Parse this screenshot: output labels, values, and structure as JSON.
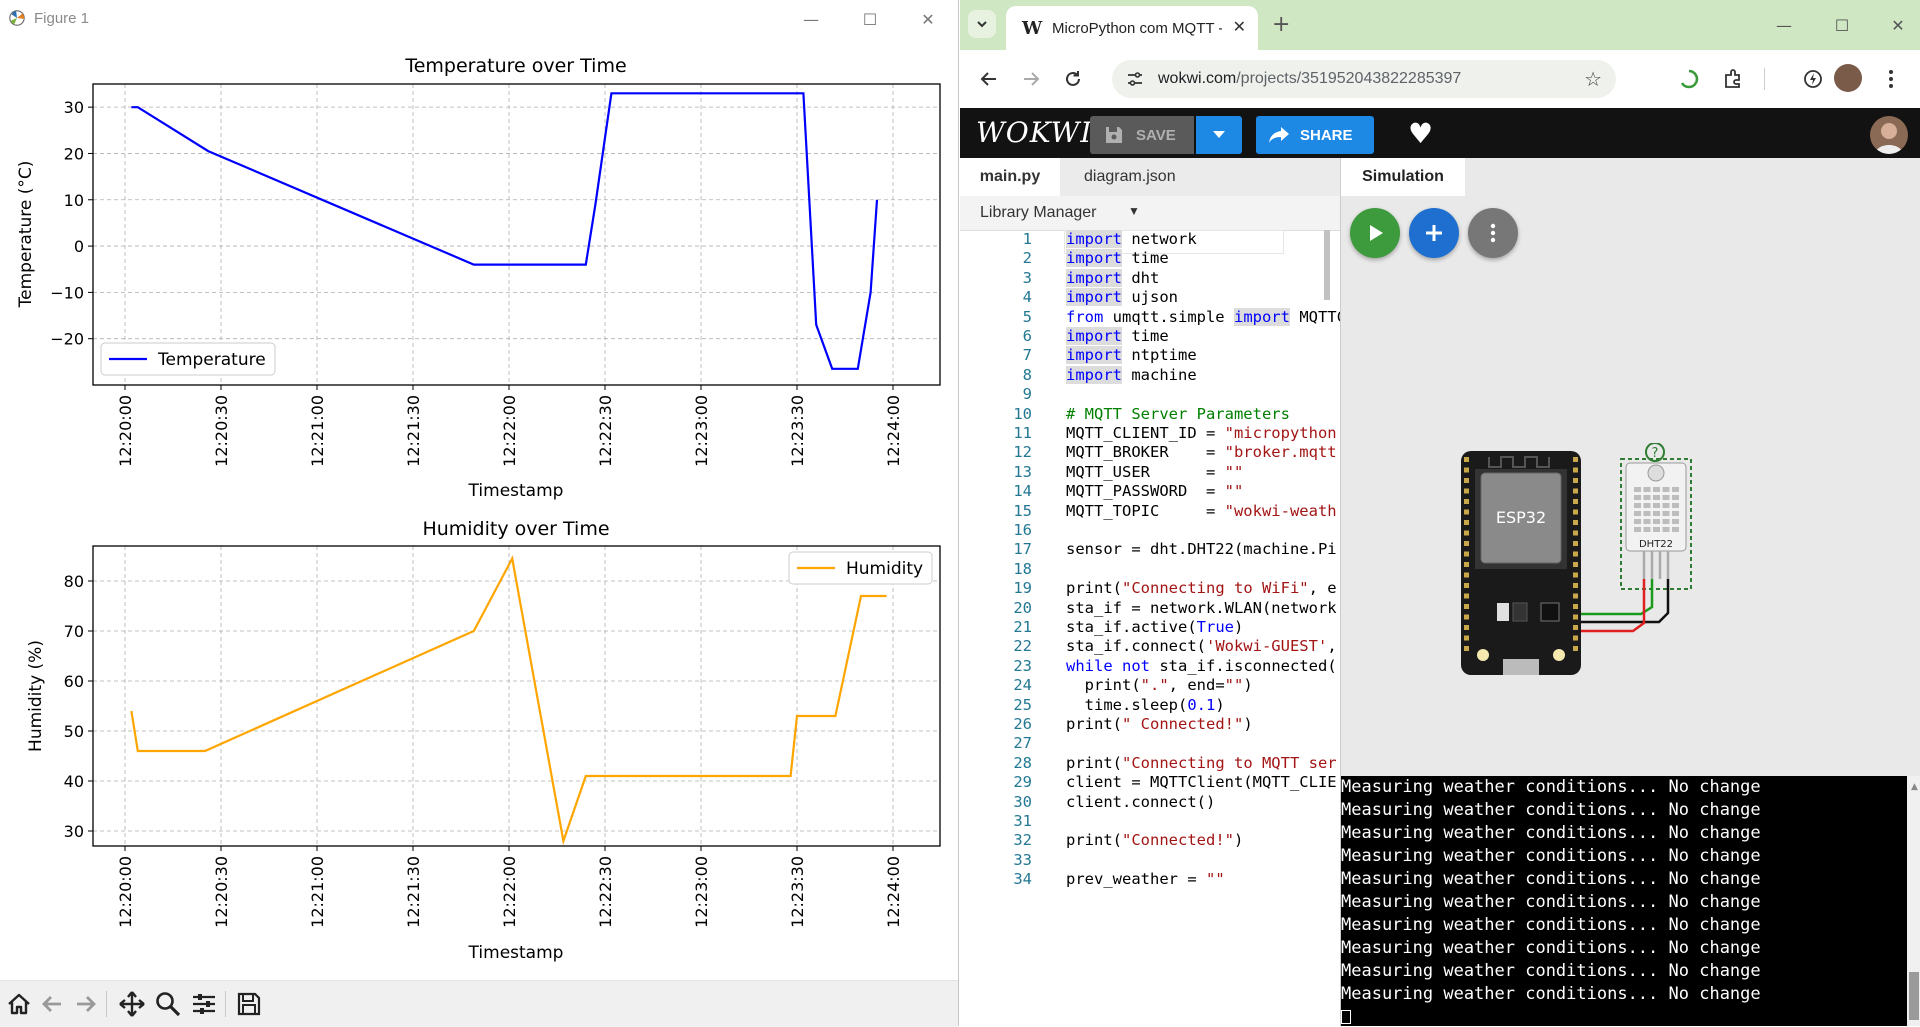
{
  "figure": {
    "window_title": "Figure 1",
    "plot1": {
      "title": "Temperature over Time",
      "ylabel": "Temperature (°C)",
      "xlabel": "Timestamp",
      "legend": "Temperature",
      "yticks": [
        "30",
        "20",
        "10",
        "0",
        "−10",
        "−20"
      ],
      "xticks": [
        "12:20:00",
        "12:20:30",
        "12:21:00",
        "12:21:30",
        "12:22:00",
        "12:22:30",
        "12:23:00",
        "12:23:30",
        "12:24:00"
      ]
    },
    "plot2": {
      "title": "Humidity over Time",
      "ylabel": "Humidity (%)",
      "xlabel": "Timestamp",
      "legend": "Humidity",
      "yticks": [
        "80",
        "70",
        "60",
        "50",
        "40",
        "30"
      ],
      "xticks": [
        "12:20:00",
        "12:20:30",
        "12:21:00",
        "12:21:30",
        "12:22:00",
        "12:22:30",
        "12:23:00",
        "12:23:30",
        "12:24:00"
      ]
    },
    "colors": {
      "temperature": "#0000ff",
      "humidity": "#ffa500"
    }
  },
  "chart_data": [
    {
      "type": "line",
      "title": "Temperature over Time",
      "xlabel": "Timestamp",
      "ylabel": "Temperature (°C)",
      "ylim": [
        -30,
        35
      ],
      "legend": "lower-left",
      "grid": true,
      "series": [
        {
          "name": "Temperature",
          "color": "#0000ff",
          "x": [
            "12:20:02",
            "12:20:04",
            "12:20:26",
            "12:21:49",
            "12:22:24",
            "12:22:27",
            "12:22:32",
            "12:23:32",
            "12:23:36",
            "12:23:41",
            "12:23:49",
            "12:23:53",
            "12:23:55"
          ],
          "y": [
            30,
            30,
            20.5,
            -4,
            -4,
            9,
            33,
            33,
            -17,
            -26.5,
            -26.5,
            -10,
            10
          ]
        }
      ]
    },
    {
      "type": "line",
      "title": "Humidity over Time",
      "xlabel": "Timestamp",
      "ylabel": "Humidity (%)",
      "ylim": [
        27,
        87
      ],
      "legend": "top-right",
      "grid": true,
      "series": [
        {
          "name": "Humidity",
          "color": "#ffa500",
          "x": [
            "12:20:02",
            "12:20:04",
            "12:20:25",
            "12:21:49",
            "12:22:01",
            "12:22:17",
            "12:22:24",
            "12:23:28",
            "12:23:30",
            "12:23:42",
            "12:23:50",
            "12:23:58"
          ],
          "y": [
            54,
            46,
            46,
            70,
            84.5,
            28,
            41,
            41,
            53,
            53,
            77,
            77
          ]
        }
      ]
    }
  ],
  "browser": {
    "tab_title": "MicroPython com MQTT - Wokwi",
    "url_host": "wokwi.com",
    "url_path": "/projects/351952043822285397"
  },
  "wokwi": {
    "logo": "WOKWI",
    "save_label": "SAVE",
    "share_label": "SHARE",
    "file_tabs": [
      "main.py",
      "diagram.json"
    ],
    "library_manager": "Library Manager",
    "sim_tab": "Simulation",
    "esp_label": "ESP32",
    "dht_label": "DHT22",
    "help_label": "?",
    "serial_lines": [
      "Measuring weather conditions... No change",
      "Measuring weather conditions... No change",
      "Measuring weather conditions... No change",
      "Measuring weather conditions... No change",
      "Measuring weather conditions... No change",
      "Measuring weather conditions... No change",
      "Measuring weather conditions... No change",
      "Measuring weather conditions... No change",
      "Measuring weather conditions... No change",
      "Measuring weather conditions... No change"
    ]
  },
  "code_lines": [
    {
      "n": "1",
      "t": "import network"
    },
    {
      "n": "2",
      "t": "import time"
    },
    {
      "n": "3",
      "t": "import dht"
    },
    {
      "n": "4",
      "t": "import ujson"
    },
    {
      "n": "5",
      "t": "from umqtt.simple import MQTTClient"
    },
    {
      "n": "6",
      "t": "import time"
    },
    {
      "n": "7",
      "t": "import ntptime"
    },
    {
      "n": "8",
      "t": "import machine"
    },
    {
      "n": "9",
      "t": ""
    },
    {
      "n": "10",
      "t": "# MQTT Server Parameters"
    },
    {
      "n": "11",
      "t": "MQTT_CLIENT_ID = \"micropython"
    },
    {
      "n": "12",
      "t": "MQTT_BROKER    = \"broker.mqtt"
    },
    {
      "n": "13",
      "t": "MQTT_USER      = \"\""
    },
    {
      "n": "14",
      "t": "MQTT_PASSWORD  = \"\""
    },
    {
      "n": "15",
      "t": "MQTT_TOPIC     = \"wokwi-weath"
    },
    {
      "n": "16",
      "t": ""
    },
    {
      "n": "17",
      "t": "sensor = dht.DHT22(machine.Pi"
    },
    {
      "n": "18",
      "t": ""
    },
    {
      "n": "19",
      "t": "print(\"Connecting to WiFi\", e"
    },
    {
      "n": "20",
      "t": "sta_if = network.WLAN(network"
    },
    {
      "n": "21",
      "t": "sta_if.active(True)"
    },
    {
      "n": "22",
      "t": "sta_if.connect('Wokwi-GUEST',"
    },
    {
      "n": "23",
      "t": "while not sta_if.isconnected("
    },
    {
      "n": "24",
      "t": "  print(\".\", end=\"\")"
    },
    {
      "n": "25",
      "t": "  time.sleep(0.1)"
    },
    {
      "n": "26",
      "t": "print(\" Connected!\")"
    },
    {
      "n": "27",
      "t": ""
    },
    {
      "n": "28",
      "t": "print(\"Connecting to MQTT ser"
    },
    {
      "n": "29",
      "t": "client = MQTTClient(MQTT_CLIE"
    },
    {
      "n": "30",
      "t": "client.connect()"
    },
    {
      "n": "31",
      "t": ""
    },
    {
      "n": "32",
      "t": "print(\"Connected!\")"
    },
    {
      "n": "33",
      "t": ""
    },
    {
      "n": "34",
      "t": "prev_weather = \"\""
    }
  ]
}
